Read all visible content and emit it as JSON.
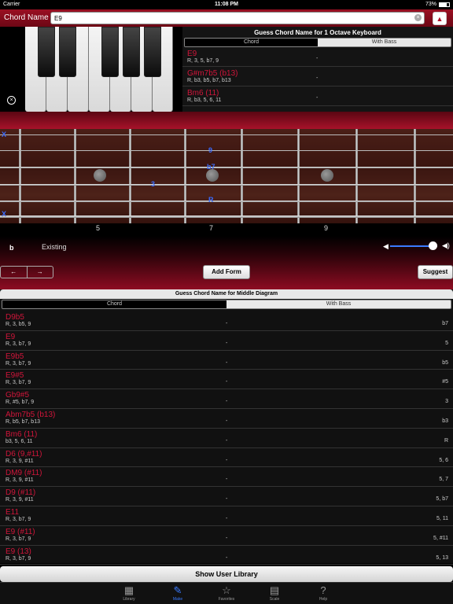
{
  "status": {
    "carrier": "Carrier",
    "time": "11:08 PM",
    "battery": "73%"
  },
  "header": {
    "label": "Chord Name",
    "chord_value": "E9",
    "up_icon": "triangle-up-icon"
  },
  "top_guess": {
    "title": "Guess Chord Name for 1 Octave Keyboard",
    "tabs": [
      "Chord",
      "With Bass"
    ],
    "rows": [
      {
        "name": "E9",
        "formula": "R, 3, 5, b7, 9",
        "dash": "-"
      },
      {
        "name": "G#m7b5 (b13)",
        "formula": "R, b3, b5, b7, b13",
        "dash": "-"
      },
      {
        "name": "Bm6 (11)",
        "formula": "R, b3, 5, 6, 11",
        "dash": "-"
      }
    ]
  },
  "fretboard": {
    "muted_top": "X",
    "muted_bottom": "X",
    "notes": [
      "9",
      "b7",
      "3",
      "R"
    ],
    "fret_numbers": [
      "5",
      "7",
      "9"
    ]
  },
  "controls": {
    "flat_symbol": "b",
    "existing_label": "Existing",
    "prev_arrow": "←",
    "next_arrow": "→",
    "add_form": "Add Form",
    "suggest": "Suggest",
    "volume": 0.9
  },
  "middle_guess": {
    "title": "Guess Chord Name for Middle Diagram",
    "tabs": [
      "Chord",
      "With Bass"
    ],
    "rows": [
      {
        "name": "D9b5",
        "formula": "R, 3, b5, 9",
        "dash": "-",
        "bass": "b7"
      },
      {
        "name": "E9",
        "formula": "R, 3, b7, 9",
        "dash": "-",
        "bass": "5"
      },
      {
        "name": "E9b5",
        "formula": "R, 3, b7, 9",
        "dash": "-",
        "bass": "b5"
      },
      {
        "name": "E9#5",
        "formula": "R, 3, b7, 9",
        "dash": "-",
        "bass": "#5"
      },
      {
        "name": "Gb9#5",
        "formula": "R, #5, b7, 9",
        "dash": "-",
        "bass": "3"
      },
      {
        "name": "Abm7b5 (b13)",
        "formula": "R, b5, b7, b13",
        "dash": "-",
        "bass": "b3"
      },
      {
        "name": "Bm6 (11)",
        "formula": "b3, 5, 6, 11",
        "dash": "-",
        "bass": "R"
      },
      {
        "name": "D6 (9,#11)",
        "formula": "R, 3, 9, #11",
        "dash": "-",
        "bass": "5, 6"
      },
      {
        "name": "DM9 (#11)",
        "formula": "R, 3, 9, #11",
        "dash": "-",
        "bass": "5, 7"
      },
      {
        "name": "D9 (#11)",
        "formula": "R, 3, 9, #11",
        "dash": "-",
        "bass": "5, b7"
      },
      {
        "name": "E11",
        "formula": "R, 3, b7, 9",
        "dash": "-",
        "bass": "5, 11"
      },
      {
        "name": "E9 (#11)",
        "formula": "R, 3, b7, 9",
        "dash": "-",
        "bass": "5, #11"
      },
      {
        "name": "E9 (13)",
        "formula": "R, 3, b7, 9",
        "dash": "-",
        "bass": "5, 13"
      }
    ]
  },
  "show_user_library": "Show User Library",
  "tabbar": [
    {
      "label": "Library",
      "icon": "piano-roll-icon"
    },
    {
      "label": "Make",
      "icon": "pencil-icon"
    },
    {
      "label": "Favorites",
      "icon": "star-icon"
    },
    {
      "label": "Scale",
      "icon": "scale-grid-icon"
    },
    {
      "label": "Help",
      "icon": "question-icon"
    }
  ],
  "colors": {
    "accent_red": "#d0153a",
    "header_red": "#9a0f22",
    "note_blue": "#3a6cff"
  }
}
